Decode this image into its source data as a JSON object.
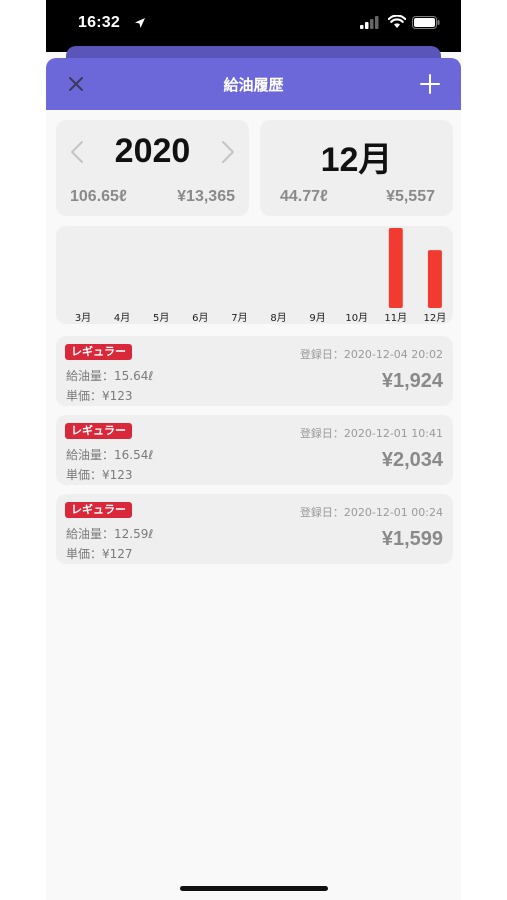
{
  "status_bar": {
    "time": "16:32"
  },
  "nav": {
    "title": "給油履歴"
  },
  "year_card": {
    "year": "2020",
    "total_volume": "106.65ℓ",
    "total_cost": "¥13,365"
  },
  "month_card": {
    "month": "12月",
    "total_volume": "44.77ℓ",
    "total_cost": "¥5,557"
  },
  "chart_data": {
    "type": "bar",
    "categories": [
      "3月",
      "4月",
      "5月",
      "6月",
      "7月",
      "8月",
      "9月",
      "10月",
      "11月",
      "12月"
    ],
    "values": [
      0,
      0,
      0,
      0,
      0,
      0,
      0,
      0,
      61.88,
      44.77
    ],
    "bar_color": "#f23b30"
  },
  "entries": [
    {
      "badge": "レギュラー",
      "amount": "給油量：15.64ℓ",
      "price": "単価：¥123",
      "date": "登録日：2020-12-04 20:02",
      "total": "¥1,924"
    },
    {
      "badge": "レギュラー",
      "amount": "給油量：16.54ℓ",
      "price": "単価：¥123",
      "date": "登録日：2020-12-01 10:41",
      "total": "¥2,034"
    },
    {
      "badge": "レギュラー",
      "amount": "給油量：12.59ℓ",
      "price": "単価：¥127",
      "date": "登録日：2020-12-01 00:24",
      "total": "¥1,599"
    }
  ],
  "colors": {
    "nav": "#6d68d9",
    "badge": "#d8283a",
    "card": "#efefef"
  }
}
